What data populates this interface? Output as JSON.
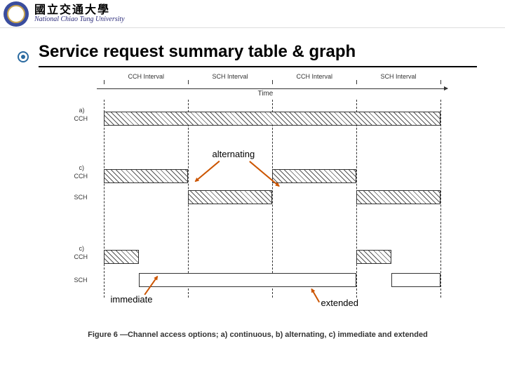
{
  "university": {
    "chinese": "國立交通大學",
    "english": "National Chiao Tung University"
  },
  "title": "Service request summary table & graph",
  "intervals": [
    "CCH Interval",
    "SCH Interval",
    "CCH Interval",
    "SCH Interval"
  ],
  "time_label": "Time",
  "rows": {
    "a": {
      "label": "a)",
      "ch": "CCH"
    },
    "b": {
      "label": "c)",
      "ch_cch": "CCH",
      "ch_sch": "SCH"
    },
    "c": {
      "label": "c)",
      "ch_cch": "CCH",
      "ch_sch": "SCH"
    }
  },
  "annotations": {
    "alternating": "alternating",
    "immediate": "immediate",
    "extended": "extended"
  },
  "caption": "Figure 6 —Channel access options; a) continuous, b) alternating, c) immediate and extended",
  "chart_data": {
    "type": "timing-diagram",
    "x_segments": [
      {
        "start": 0.0,
        "end": 0.25,
        "label": "CCH Interval"
      },
      {
        "start": 0.25,
        "end": 0.5,
        "label": "SCH Interval"
      },
      {
        "start": 0.5,
        "end": 0.75,
        "label": "CCH Interval"
      },
      {
        "start": 0.75,
        "end": 1.0,
        "label": "SCH Interval"
      }
    ],
    "variants": [
      {
        "id": "a",
        "name": "continuous",
        "channels": {
          "CCH": [
            [
              0.0,
              1.0
            ]
          ]
        }
      },
      {
        "id": "b",
        "name": "alternating",
        "channels": {
          "CCH": [
            [
              0.0,
              0.25
            ],
            [
              0.5,
              0.75
            ]
          ],
          "SCH": [
            [
              0.25,
              0.5
            ],
            [
              0.75,
              1.0
            ]
          ]
        }
      },
      {
        "id": "c",
        "name": "immediate+extended",
        "channels": {
          "CCH": [
            [
              0.0,
              0.1
            ],
            [
              0.75,
              0.85
            ]
          ],
          "SCH": [
            [
              0.1,
              0.75
            ],
            [
              0.85,
              1.0
            ]
          ]
        }
      }
    ]
  }
}
